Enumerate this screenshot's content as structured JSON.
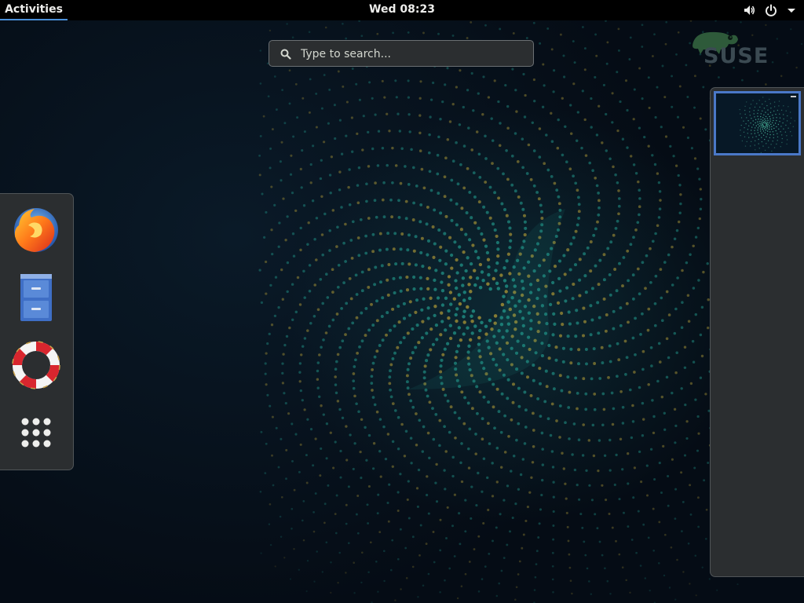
{
  "topbar": {
    "activities_label": "Activities",
    "clock": "Wed 08:23"
  },
  "system_tray": {
    "volume_icon": "volume-icon",
    "power_icon": "power-icon",
    "menu_icon": "chevron-down-icon"
  },
  "search": {
    "placeholder": "Type to search...",
    "value": ""
  },
  "branding": {
    "logo_text": "SUSE",
    "logo_color": "#3b4a52",
    "chameleon_color": "#2e5a3a"
  },
  "dash": {
    "items": [
      {
        "name": "Firefox",
        "icon": "firefox-icon"
      },
      {
        "name": "Files",
        "icon": "file-cabinet-icon"
      },
      {
        "name": "Help",
        "icon": "lifebuoy-icon"
      },
      {
        "name": "Show Applications",
        "icon": "app-grid-icon"
      }
    ]
  },
  "workspaces": {
    "count": 1,
    "active": 1,
    "accent_color": "#4a78c8"
  },
  "colors": {
    "panel_bg": "#000000",
    "overlay_bg": "#2b2e30",
    "accent": "#4a90d9",
    "wallpaper_dot_teal": "#1f8a80",
    "wallpaper_dot_gold": "#9a8a35"
  }
}
